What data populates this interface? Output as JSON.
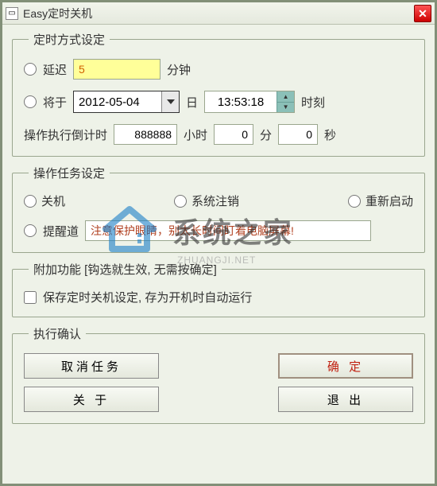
{
  "titlebar": {
    "title": "Easy定时关机"
  },
  "group_timing": {
    "legend": "定时方式设定",
    "delay_label": "延迟",
    "delay_value": "5",
    "delay_unit": "分钟",
    "at_label": "将于",
    "date_value": "2012-05-04",
    "date_unit": "日",
    "time_value": "13:53:18",
    "time_unit": "时刻",
    "countdown_label": "操作执行倒计时",
    "countdown_hours": "888888",
    "countdown_h_unit": "小时",
    "countdown_minutes": "0",
    "countdown_m_unit": "分",
    "countdown_seconds": "0",
    "countdown_s_unit": "秒"
  },
  "group_task": {
    "legend": "操作任务设定",
    "shutdown_label": "关机",
    "logoff_label": "系统注销",
    "restart_label": "重新启动",
    "reminder_label": "提醒道",
    "reminder_value": "注意保护眼睛，别太长时间盯着电脑屏幕!"
  },
  "group_addon": {
    "legend": "附加功能 [钩选就生效, 无需按确定]",
    "save_label": "保存定时关机设定, 存为开机时自动运行"
  },
  "group_confirm": {
    "legend": "执行确认",
    "cancel_task": "取消任务",
    "ok": "确 定",
    "about": "关 于",
    "exit": "退 出"
  },
  "watermark": {
    "text": "系统之家",
    "sub": "ZHUANGJI.NET"
  }
}
